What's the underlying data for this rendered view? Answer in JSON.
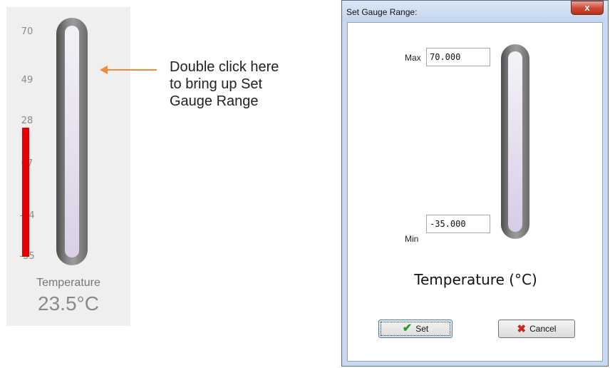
{
  "gauge": {
    "ticks": [
      "70",
      "49",
      "28",
      "07",
      "-14",
      "-35"
    ],
    "name": "Temperature",
    "value": "23.5°C",
    "min": -35,
    "max": 70,
    "level": 23.5,
    "fluid_color": "#e40000"
  },
  "annotation": {
    "lines": [
      "Double click here",
      "to bring up Set",
      "Gauge Range"
    ],
    "arrow_color": "#f08a3c"
  },
  "dialog": {
    "title": "Set Gauge Range:",
    "close_label": "x",
    "max_label": "Max",
    "max_value": "70.000",
    "min_label": "Min",
    "min_value": "-35.000",
    "gauge_name": "Temperature (°C)",
    "set_label": "Set",
    "cancel_label": "Cancel"
  }
}
